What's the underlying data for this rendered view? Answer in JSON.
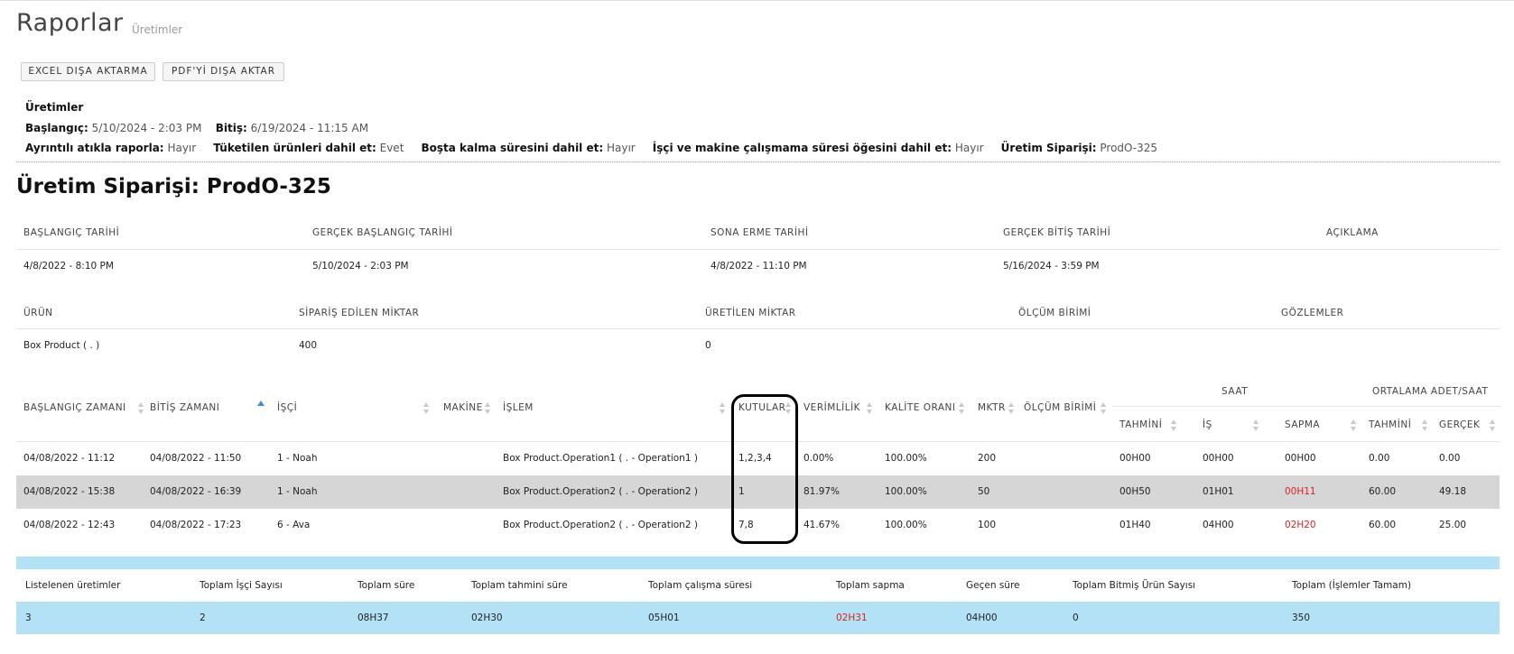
{
  "header": {
    "title": "Raporlar",
    "subtitle": "Üretimler"
  },
  "buttons": {
    "excel": "EXCEL DIŞA AKTARMA",
    "pdf": "PDF'Yİ DIŞA AKTAR"
  },
  "report_info": {
    "name": "Üretimler",
    "start_label": "Başlangıç:",
    "start_value": "5/10/2024 - 2:03 PM",
    "end_label": "Bitiş:",
    "end_value": "6/19/2024 - 11:15 AM",
    "filters": [
      {
        "label": "Ayrıntılı atıkla raporla:",
        "value": "Hayır"
      },
      {
        "label": "Tüketilen ürünleri dahil et:",
        "value": "Evet"
      },
      {
        "label": "Boşta kalma süresini dahil et:",
        "value": "Hayır"
      },
      {
        "label": "İşçi ve makine çalışmama süresi öğesini dahil et:",
        "value": "Hayır"
      },
      {
        "label": "Üretim Siparişi:",
        "value": "ProdO-325"
      }
    ]
  },
  "order": {
    "title": "Üretim Siparişi: ProdO-325",
    "dates_headers": [
      "BAŞLANGIÇ TARİHİ",
      "GERÇEK BAŞLANGIÇ TARİHİ",
      "SONA ERME TARİHİ",
      "GERÇEK BİTİŞ TARİHİ",
      "AÇIKLAMA"
    ],
    "dates_values": [
      "4/8/2022 - 8:10 PM",
      "5/10/2024 - 2:03 PM",
      "4/8/2022 - 11:10 PM",
      "5/16/2024 - 3:59 PM",
      ""
    ],
    "product_headers": [
      "ÜRÜN",
      "SİPARİŞ EDİLEN MİKTAR",
      "ÜRETİLEN MİKTAR",
      "ÖLÇÜM BİRİMİ",
      "GÖZLEMLER"
    ],
    "product_values": [
      "Box Product ( . )",
      "400",
      "0",
      "",
      ""
    ]
  },
  "table": {
    "group_headers": {
      "saat": "SAAT",
      "ortalama": "ORTALAMA ADET/SAAT"
    },
    "columns": [
      "BAŞLANGIÇ ZAMANI",
      "BİTİŞ ZAMANI",
      "İŞÇİ",
      "MAKİNE",
      "İŞLEM",
      "KUTULAR",
      "VERİMLİLİK",
      "KALİTE ORANI",
      "MKTR",
      "ÖLÇÜM BİRİMİ"
    ],
    "sub_columns": [
      "TAHMİNİ",
      "İŞ",
      "SAPMA",
      "TAHMİNİ",
      "GERÇEK"
    ],
    "rows": [
      [
        "04/08/2022 - 11:12",
        "04/08/2022 - 11:50",
        "1 - Noah",
        "",
        "Box Product.Operation1 ( . - Operation1 )",
        "1,2,3,4",
        "0.00%",
        "100.00%",
        "200",
        "",
        "00H00",
        "00H00",
        "00H00",
        "0.00",
        "0.00"
      ],
      [
        "04/08/2022 - 15:38",
        "04/08/2022 - 16:39",
        "1 - Noah",
        "",
        "Box Product.Operation2 ( . - Operation2 )",
        "1",
        "81.97%",
        "100.00%",
        "50",
        "",
        "00H50",
        "01H01",
        "00H11",
        "60.00",
        "49.18"
      ],
      [
        "04/08/2022 - 12:43",
        "04/08/2022 - 17:23",
        "6 - Ava",
        "",
        "Box Product.Operation2 ( . - Operation2 )",
        "7,8",
        "41.67%",
        "100.00%",
        "100",
        "",
        "01H40",
        "04H00",
        "02H20",
        "60.00",
        "25.00"
      ]
    ]
  },
  "summary": {
    "headers": [
      "Listelenen üretimler",
      "Toplam İşçi Sayısı",
      "Toplam süre",
      "Toplam tahmini süre",
      "Toplam çalışma süresi",
      "Toplam sapma",
      "Geçen süre",
      "Toplam Bitmiş Ürün Sayısı",
      "Toplam (İşlemler Tamam)"
    ],
    "values": [
      "3",
      "2",
      "08H37",
      "02H30",
      "05H01",
      "02H31",
      "04H00",
      "0",
      "350"
    ]
  },
  "colors": {
    "highlight_row": "#d6d6d6",
    "summary_bg": "#b3e2f7",
    "negative": "#e02020",
    "sort_active": "#3d8fd4"
  }
}
